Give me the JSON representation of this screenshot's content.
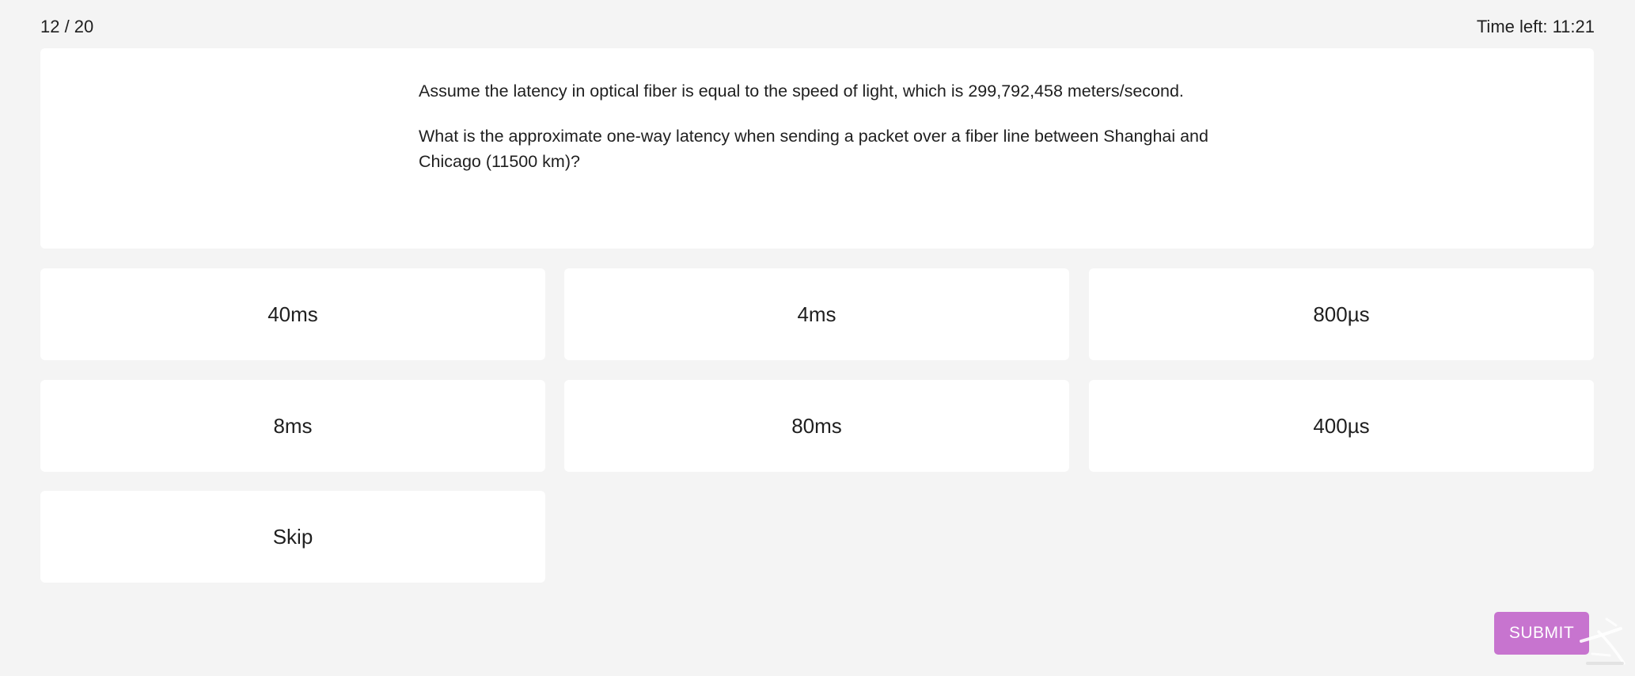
{
  "header": {
    "progress": "12 / 20",
    "timer": "Time left: 11:21"
  },
  "question": {
    "paragraph1": "Assume the latency in optical fiber is equal to the speed of light, which is 299,792,458 meters/second.",
    "paragraph2": "What is the approximate one-way latency when sending a packet over a fiber line between Shanghai and Chicago (11500 km)?"
  },
  "answers": [
    {
      "label": "40ms"
    },
    {
      "label": "4ms"
    },
    {
      "label": "800µs"
    },
    {
      "label": "8ms"
    },
    {
      "label": "80ms"
    },
    {
      "label": "400µs"
    },
    {
      "label": "Skip"
    }
  ],
  "actions": {
    "submit_label": "SUBMIT"
  },
  "colors": {
    "background": "#f4f4f4",
    "card": "#ffffff",
    "submit": "#c774cf"
  }
}
